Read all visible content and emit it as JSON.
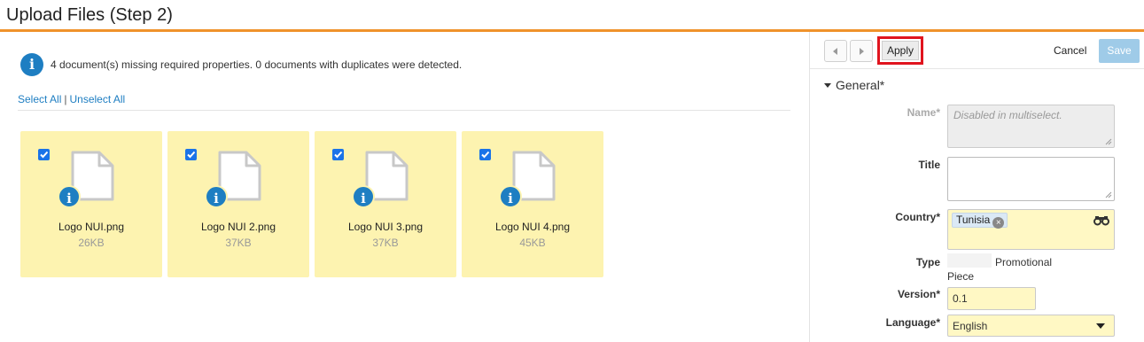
{
  "header": {
    "title": "Upload Files (Step 2)"
  },
  "notice": {
    "text": "4 document(s) missing required properties. 0 documents with duplicates were detected."
  },
  "selection": {
    "select_all": "Select All",
    "separator": "|",
    "unselect_all": "Unselect All"
  },
  "files": [
    {
      "name": "Logo NUI.png",
      "size": "26KB",
      "checked": true
    },
    {
      "name": "Logo NUI 2.png",
      "size": "37KB",
      "checked": true
    },
    {
      "name": "Logo NUI 3.png",
      "size": "37KB",
      "checked": true
    },
    {
      "name": "Logo NUI 4.png",
      "size": "45KB",
      "checked": true
    }
  ],
  "toolbar": {
    "apply_label": "Apply",
    "cancel_label": "Cancel",
    "save_label": "Save"
  },
  "properties": {
    "section_title": "General*",
    "name": {
      "label": "Name*",
      "placeholder": "Disabled in multiselect."
    },
    "title": {
      "label": "Title",
      "value": ""
    },
    "country": {
      "label": "Country*",
      "chips": [
        "Tunisia"
      ]
    },
    "type": {
      "label": "Type",
      "value_line1": "Promotional",
      "value_line2": "Piece"
    },
    "version": {
      "label": "Version*",
      "value": "0.1"
    },
    "language": {
      "label": "Language*",
      "value": "English"
    }
  },
  "colors": {
    "accent": "#f0922b",
    "info_blue": "#1e7ec2",
    "card_background": "#fdf3b0",
    "highlight_border": "#e0141e",
    "save_disabled": "#9fcbe8"
  }
}
